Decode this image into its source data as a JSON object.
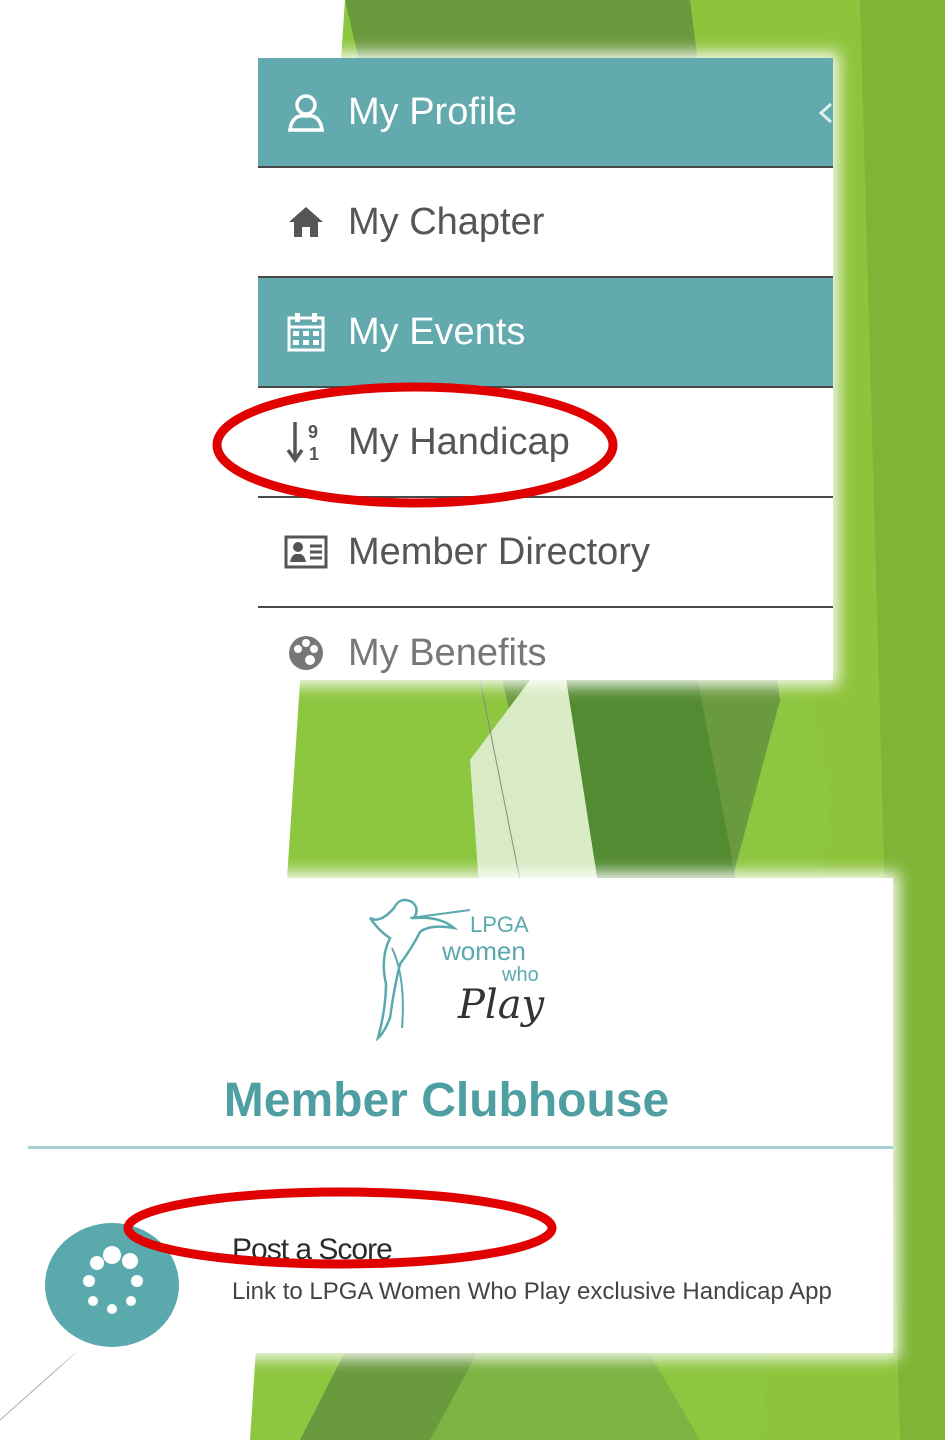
{
  "menu": {
    "items": [
      {
        "label": "My Profile",
        "icon": "person-icon",
        "active": true
      },
      {
        "label": "My Chapter",
        "icon": "home-icon",
        "active": false
      },
      {
        "label": "My Events",
        "icon": "calendar-icon",
        "active": true
      },
      {
        "label": "My Handicap",
        "icon": "sort-numeric-icon",
        "active": false
      },
      {
        "label": "Member Directory",
        "icon": "address-card-icon",
        "active": false
      },
      {
        "label": "My Benefits",
        "icon": "palette-icon",
        "active": false
      }
    ]
  },
  "logo": {
    "line1": "LPGA",
    "line2": "women",
    "line3": "who",
    "line4": "Play"
  },
  "clubhouse": {
    "title": "Member Clubhouse",
    "post_score": {
      "title": "Post a Score",
      "description": "Link to LPGA Women Who Play exclusive Handicap App"
    }
  },
  "colors": {
    "teal": "#62aaae",
    "green": "#8cc63f",
    "highlight_red": "#e00000"
  }
}
